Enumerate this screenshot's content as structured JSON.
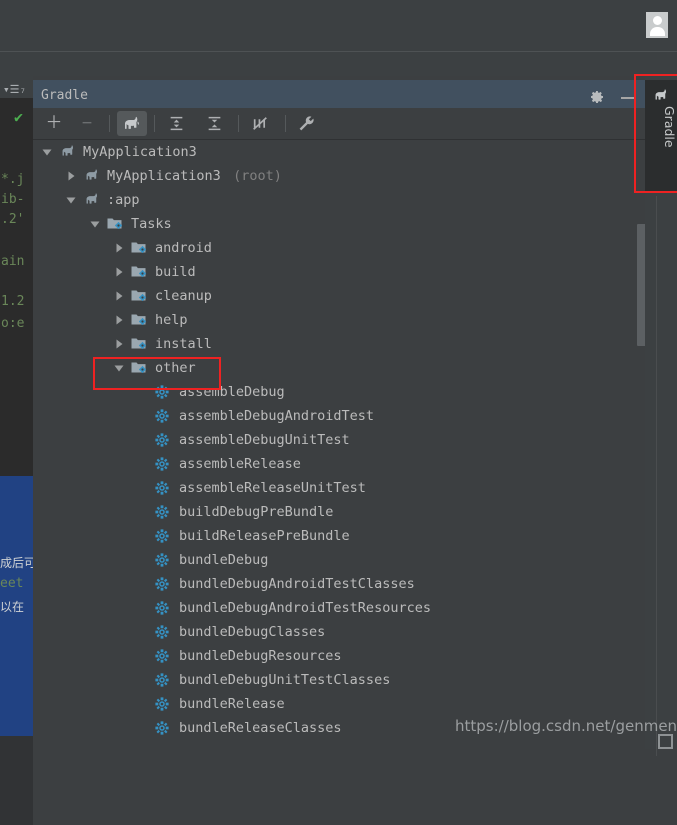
{
  "window": {
    "avatar": "user-avatar-icon"
  },
  "editor": {
    "code_fragments": [
      "*.j",
      "ib-",
      ".2'",
      "ain",
      "1.2",
      "o:e"
    ],
    "selection_fragments": [
      "成后可",
      "eet",
      "以在"
    ],
    "hamburger": "▾☰₇",
    "checkmark": "✔"
  },
  "tool_window": {
    "title": "Gradle",
    "settings_icon": "gear-icon",
    "minimize_icon": "minimize-icon",
    "toolbar": [
      {
        "name": "add-button",
        "glyph": "+",
        "enabled": true,
        "selected": false
      },
      {
        "name": "remove-button",
        "glyph": "−",
        "enabled": false,
        "selected": false
      },
      {
        "name": "execute-gradle-task-button",
        "glyph": "elephant",
        "enabled": true,
        "selected": true
      },
      {
        "name": "expand-all-button",
        "glyph": "expand",
        "enabled": true,
        "selected": false
      },
      {
        "name": "collapse-all-button",
        "glyph": "collapse",
        "enabled": true,
        "selected": false
      },
      {
        "name": "toggle-offline-mode-button",
        "glyph": "offline",
        "enabled": true,
        "selected": false
      },
      {
        "name": "gradle-settings-button",
        "glyph": "wrench",
        "enabled": true,
        "selected": false
      }
    ]
  },
  "tree": [
    {
      "label": "MyApplication3",
      "suffix": "",
      "depth": 0,
      "icon": "elephant-icon",
      "state": "expanded"
    },
    {
      "label": "MyApplication3",
      "suffix": " (root)",
      "depth": 1,
      "icon": "elephant-icon",
      "state": "collapsed"
    },
    {
      "label": ":app",
      "suffix": "",
      "depth": 1,
      "icon": "elephant-icon",
      "state": "expanded"
    },
    {
      "label": "Tasks",
      "suffix": "",
      "depth": 2,
      "icon": "task-folder-icon",
      "state": "expanded"
    },
    {
      "label": "android",
      "suffix": "",
      "depth": 3,
      "icon": "task-folder-icon",
      "state": "collapsed"
    },
    {
      "label": "build",
      "suffix": "",
      "depth": 3,
      "icon": "task-folder-icon",
      "state": "collapsed"
    },
    {
      "label": "cleanup",
      "suffix": "",
      "depth": 3,
      "icon": "task-folder-icon",
      "state": "collapsed"
    },
    {
      "label": "help",
      "suffix": "",
      "depth": 3,
      "icon": "task-folder-icon",
      "state": "collapsed"
    },
    {
      "label": "install",
      "suffix": "",
      "depth": 3,
      "icon": "task-folder-icon",
      "state": "collapsed"
    },
    {
      "label": "other",
      "suffix": "",
      "depth": 3,
      "icon": "task-folder-icon",
      "state": "expanded"
    },
    {
      "label": "assembleDebug",
      "suffix": "",
      "depth": 4,
      "icon": "gear-task-icon",
      "state": "leaf"
    },
    {
      "label": "assembleDebugAndroidTest",
      "suffix": "",
      "depth": 4,
      "icon": "gear-task-icon",
      "state": "leaf"
    },
    {
      "label": "assembleDebugUnitTest",
      "suffix": "",
      "depth": 4,
      "icon": "gear-task-icon",
      "state": "leaf"
    },
    {
      "label": "assembleRelease",
      "suffix": "",
      "depth": 4,
      "icon": "gear-task-icon",
      "state": "leaf"
    },
    {
      "label": "assembleReleaseUnitTest",
      "suffix": "",
      "depth": 4,
      "icon": "gear-task-icon",
      "state": "leaf"
    },
    {
      "label": "buildDebugPreBundle",
      "suffix": "",
      "depth": 4,
      "icon": "gear-task-icon",
      "state": "leaf"
    },
    {
      "label": "buildReleasePreBundle",
      "suffix": "",
      "depth": 4,
      "icon": "gear-task-icon",
      "state": "leaf"
    },
    {
      "label": "bundleDebug",
      "suffix": "",
      "depth": 4,
      "icon": "gear-task-icon",
      "state": "leaf"
    },
    {
      "label": "bundleDebugAndroidTestClasses",
      "suffix": "",
      "depth": 4,
      "icon": "gear-task-icon",
      "state": "leaf"
    },
    {
      "label": "bundleDebugAndroidTestResources",
      "suffix": "",
      "depth": 4,
      "icon": "gear-task-icon",
      "state": "leaf"
    },
    {
      "label": "bundleDebugClasses",
      "suffix": "",
      "depth": 4,
      "icon": "gear-task-icon",
      "state": "leaf"
    },
    {
      "label": "bundleDebugResources",
      "suffix": "",
      "depth": 4,
      "icon": "gear-task-icon",
      "state": "leaf"
    },
    {
      "label": "bundleDebugUnitTestClasses",
      "suffix": "",
      "depth": 4,
      "icon": "gear-task-icon",
      "state": "leaf"
    },
    {
      "label": "bundleRelease",
      "suffix": "",
      "depth": 4,
      "icon": "gear-task-icon",
      "state": "leaf"
    },
    {
      "label": "bundleReleaseClasses",
      "suffix": "",
      "depth": 4,
      "icon": "gear-task-icon",
      "state": "leaf"
    }
  ],
  "sidebar": {
    "tab_label": "Gradle",
    "tab_icon": "elephant-icon"
  },
  "annotations": [
    {
      "name": "gradle-sidebar-tab-highlight"
    },
    {
      "name": "other-task-group-highlight"
    }
  ],
  "watermark": {
    "text": "https://blog.csdn.net/genmenu"
  },
  "colors": {
    "panel_bg": "#3c3f41",
    "header_bg": "#41505f",
    "tree_text": "#bbbbbb",
    "gear_icon": "#3592c4",
    "folder_icon": "#9aa7b0",
    "annotation_red": "#ee2222",
    "selection_blue": "#214283",
    "code_green": "#6a8759"
  }
}
